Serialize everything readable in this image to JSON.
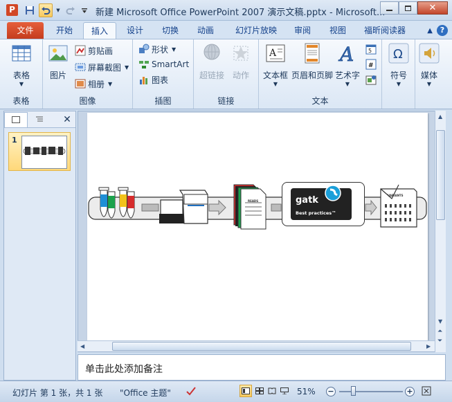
{
  "titlebar": {
    "app_letter": "P",
    "title": "新建 Microsoft Office PowerPoint 2007 演示文稿.pptx  -  Microsoft..."
  },
  "tabs": [
    "文件",
    "开始",
    "插入",
    "设计",
    "切换",
    "动画",
    "幻灯片放映",
    "审阅",
    "视图",
    "福昕阅读器"
  ],
  "active_tab": "插入",
  "ribbon": {
    "groups": {
      "tables": "表格",
      "images": "图像",
      "illustrations": "插图",
      "links": "链接",
      "text": "文本"
    },
    "buttons": {
      "table": "表格",
      "picture": "图片",
      "clipart": "剪贴画",
      "screenshot": "屏幕截图",
      "album": "相册",
      "shapes": "形状",
      "smartart": "SmartArt",
      "chart": "图表",
      "hyperlink": "超链接",
      "action": "动作",
      "textbox": "文本框",
      "header_footer": "页眉和页脚",
      "wordart": "艺术字",
      "symbol": "符号",
      "media": "媒体"
    }
  },
  "slides_pane": {
    "slide_number": "1"
  },
  "slide": {
    "reads_label": "READS",
    "variants_label": "VARIANTS",
    "gatk_word": "gatk",
    "gatk_sub": "Best practices™"
  },
  "notes": {
    "placeholder": "单击此处添加备注"
  },
  "statusbar": {
    "slide_info": "幻灯片 第 1 张，共 1 张",
    "theme": "\"Office 主题\"",
    "zoom": "51%"
  },
  "colors": {
    "file_tab": "#d24726",
    "accent": "#2f6fc1"
  }
}
